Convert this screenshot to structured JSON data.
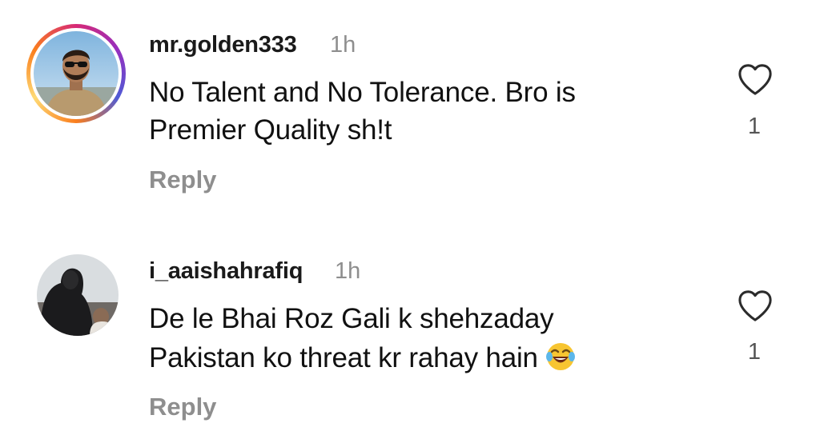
{
  "comments": [
    {
      "username": "mr.golden333",
      "time": "1h",
      "text_lines": [
        "No Talent and No Tolerance. Bro is",
        "Premier Quality sh!t"
      ],
      "reply_label": "Reply",
      "likes": "1",
      "avatar_icon": "user-avatar-with-story-ring",
      "like_icon": "heart-outline-icon"
    },
    {
      "username": "i_aaishahrafiq",
      "time": "1h",
      "text_lines": [
        "De le Bhai Roz Gali k shehzaday",
        "Pakistan ko threat kr rahay hain"
      ],
      "emoji": "😂",
      "reply_label": "Reply",
      "likes": "1",
      "avatar_icon": "user-avatar",
      "like_icon": "heart-outline-icon"
    }
  ],
  "colors": {
    "text": "#111111",
    "secondary": "#8e8e8e",
    "story_ring": [
      "#d62976",
      "#962fbf",
      "#4f5bd5",
      "#fa7e1e",
      "#feda75"
    ]
  }
}
